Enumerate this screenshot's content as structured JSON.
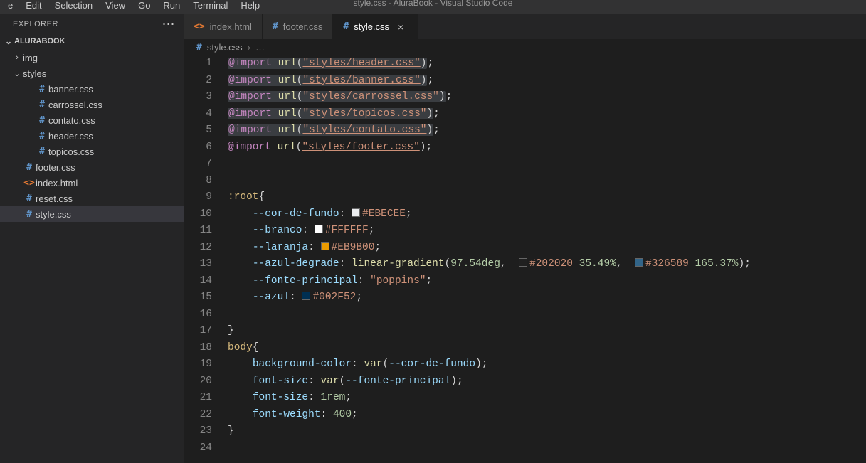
{
  "menus": [
    "e",
    "Edit",
    "Selection",
    "View",
    "Go",
    "Run",
    "Terminal",
    "Help"
  ],
  "windowTitle": "style.css - AluraBook - Visual Studio Code",
  "sidebar": {
    "title": "EXPLORER",
    "section": "ALURABOOK",
    "tree": [
      {
        "indent": 16,
        "chev": "›",
        "icon": "",
        "iconCls": "",
        "label": "img"
      },
      {
        "indent": 16,
        "chev": "⌄",
        "icon": "",
        "iconCls": "",
        "label": "styles"
      },
      {
        "indent": 34,
        "chev": "",
        "icon": "#",
        "iconCls": "icon-hash",
        "label": "banner.css"
      },
      {
        "indent": 34,
        "chev": "",
        "icon": "#",
        "iconCls": "icon-hash",
        "label": "carrossel.css"
      },
      {
        "indent": 34,
        "chev": "",
        "icon": "#",
        "iconCls": "icon-hash",
        "label": "contato.css"
      },
      {
        "indent": 34,
        "chev": "",
        "icon": "#",
        "iconCls": "icon-hash",
        "label": "header.css"
      },
      {
        "indent": 34,
        "chev": "",
        "icon": "#",
        "iconCls": "icon-hash",
        "label": "topicos.css"
      },
      {
        "indent": 16,
        "chev": "",
        "icon": "#",
        "iconCls": "icon-hash",
        "label": "footer.css"
      },
      {
        "indent": 16,
        "chev": "",
        "icon": "<>",
        "iconCls": "icon-html",
        "label": "index.html"
      },
      {
        "indent": 16,
        "chev": "",
        "icon": "#",
        "iconCls": "icon-hash",
        "label": "reset.css"
      },
      {
        "indent": 16,
        "chev": "",
        "icon": "#",
        "iconCls": "icon-hash",
        "label": "style.css",
        "active": true
      }
    ]
  },
  "tabs": [
    {
      "icon": "<>",
      "iconCls": "icon-html",
      "label": "index.html",
      "active": false,
      "close": false
    },
    {
      "icon": "#",
      "iconCls": "icon-hash",
      "label": "footer.css",
      "active": false,
      "close": false
    },
    {
      "icon": "#",
      "iconCls": "icon-hash",
      "label": "style.css",
      "active": true,
      "close": true
    }
  ],
  "breadcrumbs": {
    "file": "style.css",
    "rest": "…"
  },
  "code": {
    "imports": [
      "styles/header.css",
      "styles/banner.css",
      "styles/carrossel.css",
      "styles/topicos.css",
      "styles/contato.css",
      "styles/footer.css"
    ],
    "root_vars": {
      "cor_de_fundo": "#EBECEE",
      "branco": "#FFFFFF",
      "laranja": "#EB9B00",
      "azul_degrade_deg": "97.54deg",
      "azul_degrade_c1": "#202020",
      "azul_degrade_p1": "35.49%",
      "azul_degrade_c2": "#326589",
      "azul_degrade_p2": "165.37%",
      "fonte_principal": "\"poppins\"",
      "azul": "#002F52"
    },
    "body": {
      "bg_var": "--cor-de-fundo",
      "font_var": "--fonte-principal",
      "font_size": "1rem",
      "font_weight": "400"
    }
  }
}
